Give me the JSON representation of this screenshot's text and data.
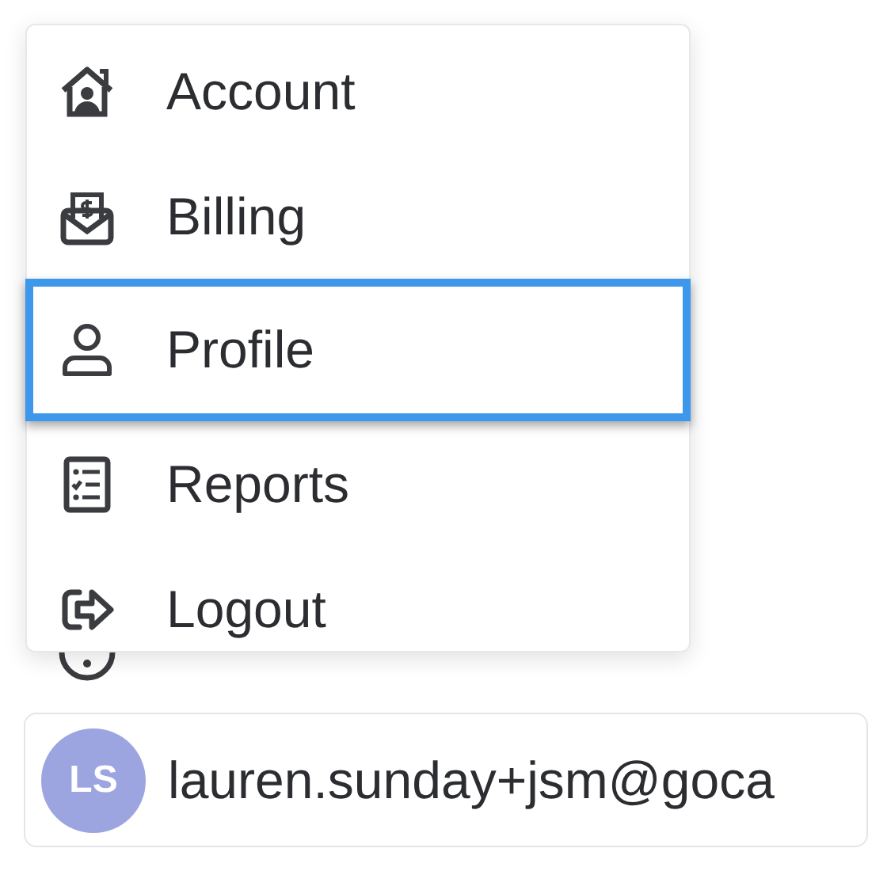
{
  "menu": {
    "items": [
      {
        "label": "Account",
        "selected": false
      },
      {
        "label": "Billing",
        "selected": false
      },
      {
        "label": "Profile",
        "selected": true
      },
      {
        "label": "Reports",
        "selected": false
      },
      {
        "label": "Logout",
        "selected": false
      }
    ]
  },
  "user": {
    "initials": "LS",
    "email": "lauren.sunday+jsm@goca"
  }
}
